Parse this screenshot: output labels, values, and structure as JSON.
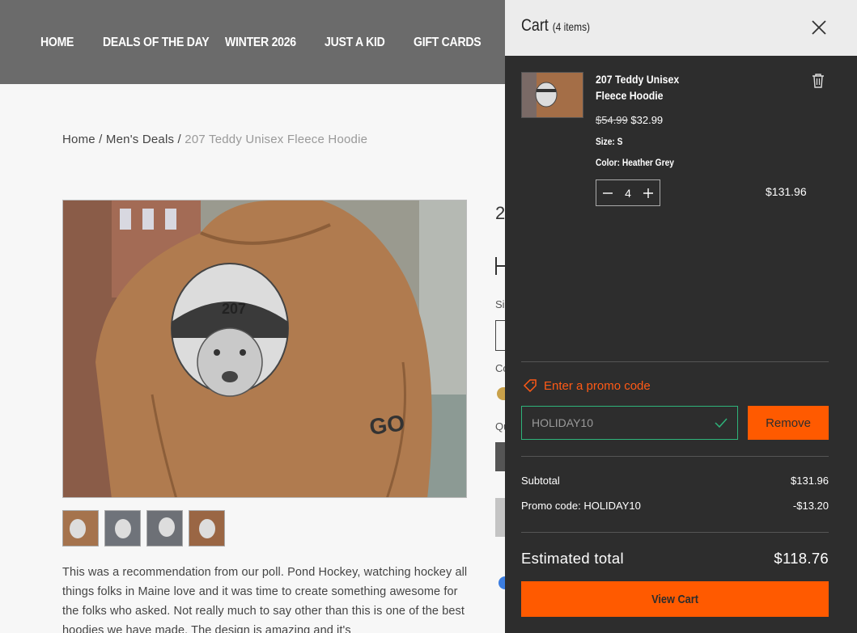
{
  "nav": {
    "items": [
      {
        "label": "HOME"
      },
      {
        "label": "DEALS OF THE DAY"
      },
      {
        "label": "WINTER 2026"
      },
      {
        "label": "JUST A KID"
      },
      {
        "label": "GIFT CARDS"
      }
    ]
  },
  "breadcrumb": {
    "home": "Home",
    "sep1": " / ",
    "category": "Men's Deals",
    "sep2": " / ",
    "current": "207 Teddy Unisex Fleece Hoodie"
  },
  "product": {
    "description": "This was a recommendation from our poll. Pond Hockey, watching hockey all things folks in Maine love and it was time to create something awesome for the folks who asked. Not really much to say other than this is one of the best hoodies we have made. The design is amazing and it's",
    "title_partial": "2",
    "size_label_partial": "Si",
    "color_label_partial": "Co",
    "qty_label_partial": "Qu"
  },
  "cart": {
    "title": "Cart",
    "count": "(4 items)",
    "item": {
      "name": "207 Teddy Unisex Fleece Hoodie",
      "original_price": "$54.99",
      "sale_price": "$32.99",
      "size": "Size: S",
      "color": "Color: Heather Grey",
      "quantity": "4",
      "line_total": "$131.96"
    },
    "promo_link": "Enter a promo code",
    "promo_value": "HOLIDAY10",
    "remove_label": "Remove",
    "subtotal_label": "Subtotal",
    "subtotal_value": "$131.96",
    "promo_label": "Promo code: HOLIDAY10",
    "promo_discount": "-$13.20",
    "estimated_label": "Estimated total",
    "estimated_value": "$118.76",
    "view_cart_label": "View Cart"
  },
  "colors": {
    "accent": "#ff5a00",
    "header_bg": "#6b6b6b",
    "drawer_bg": "#2d2d2d",
    "promo_border": "#2eb37a"
  }
}
